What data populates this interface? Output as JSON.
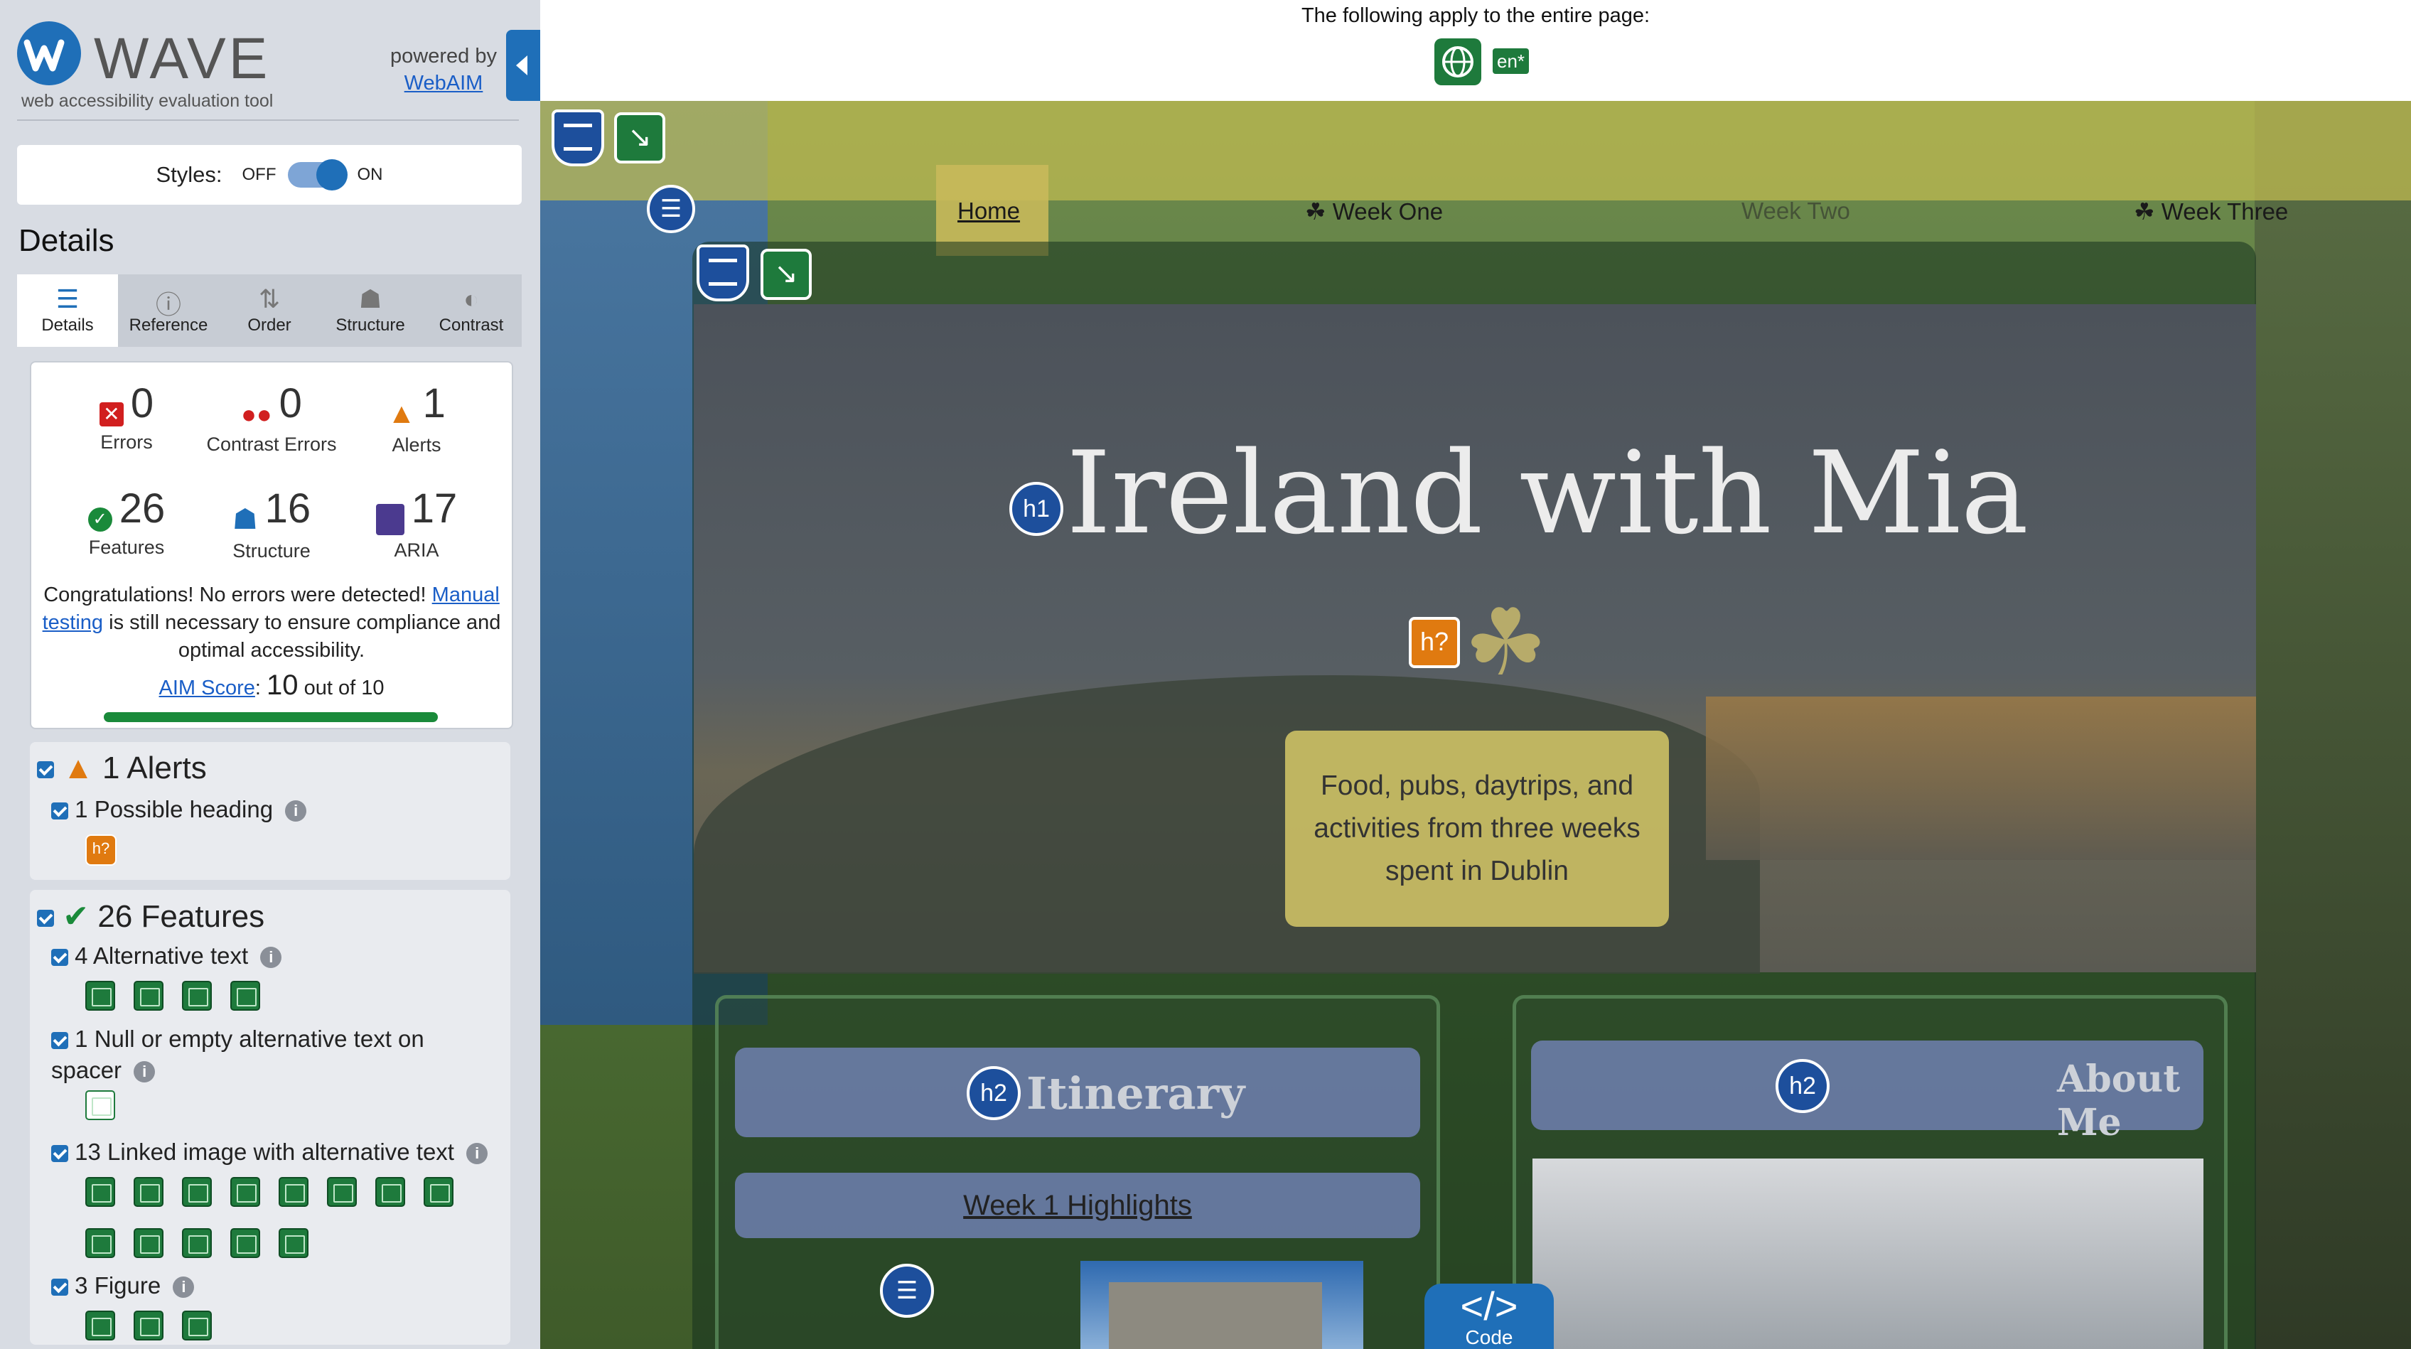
{
  "wave": {
    "title": "WAVE",
    "subtitle": "web accessibility evaluation tool",
    "powered_by": "powered by",
    "webaim_link": "WebAIM",
    "styles_label": "Styles:",
    "styles_off": "OFF",
    "styles_on": "ON",
    "details_heading": "Details",
    "tabs": [
      {
        "label": "Details",
        "icon": "list-icon",
        "active": true
      },
      {
        "label": "Reference",
        "icon": "info-icon",
        "active": false
      },
      {
        "label": "Order",
        "icon": "order-icon",
        "active": false
      },
      {
        "label": "Structure",
        "icon": "structure-icon",
        "active": false
      },
      {
        "label": "Contrast",
        "icon": "contrast-icon",
        "active": false
      }
    ],
    "summary": {
      "errors": {
        "value": "0",
        "label": "Errors",
        "color": "#d11f1f"
      },
      "contrast_errors": {
        "value": "0",
        "label": "Contrast Errors",
        "color": "#d11f1f"
      },
      "alerts": {
        "value": "1",
        "label": "Alerts",
        "color": "#e07a10"
      },
      "features": {
        "value": "26",
        "label": "Features",
        "color": "#1a8a3a"
      },
      "structure": {
        "value": "16",
        "label": "Structure",
        "color": "#1f6fb8"
      },
      "aria": {
        "value": "17",
        "label": "ARIA",
        "color": "#4b3a8f"
      }
    },
    "congrats_1": "Congratulations! No errors were detected! ",
    "congrats_manual": "Manual testing",
    "congrats_2": " is still necessary to ensure compliance and optimal accessibility.",
    "aim_link": "AIM Score",
    "aim_sep": ": ",
    "aim_score": "10",
    "aim_suffix": " out of 10",
    "alerts_panel": {
      "heading": "1 Alerts",
      "items": [
        {
          "label": "1 Possible heading"
        }
      ]
    },
    "features_panel": {
      "heading": "26 Features",
      "items": [
        {
          "label": "4 Alternative text"
        },
        {
          "label": "1 Null or empty alternative text on spacer"
        },
        {
          "label": "13 Linked image with alternative text"
        },
        {
          "label": "3 Figure"
        }
      ]
    }
  },
  "page": {
    "top_message": "The following apply to the entire page:",
    "lang_badge": "en*",
    "nav": {
      "home": "Home",
      "week_one": "☘ Week One",
      "week_two": "Week Two",
      "week_three": "☘ Week Three"
    },
    "title": "Ireland with Mia",
    "tagline": "Food, pubs, daytrips, and activities from three weeks spent in Dublin",
    "itinerary_heading": "Itinerary",
    "about_heading": "About Me",
    "week1_link": "Week 1 Highlights",
    "code_tab_glyph": "</>",
    "code_tab_label": "Code",
    "icons": {
      "h1": "h1",
      "h2": "h2",
      "possible_heading": "h?"
    }
  }
}
